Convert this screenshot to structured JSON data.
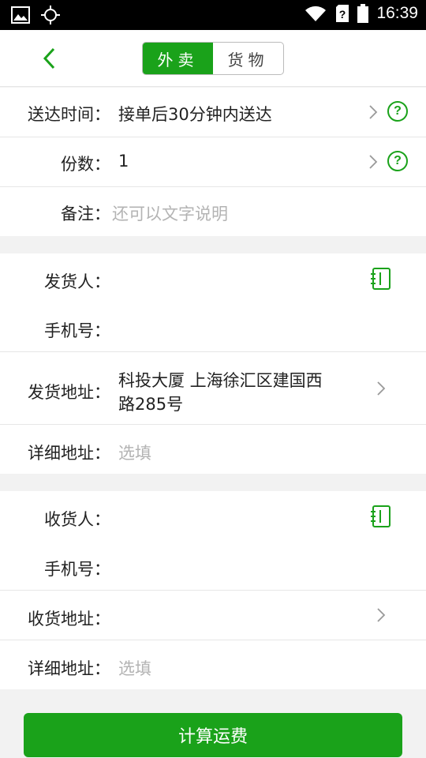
{
  "status_bar": {
    "time": "16:39",
    "icons": [
      "image-icon",
      "gps-icon",
      "wifi-icon",
      "sim-icon",
      "battery-icon"
    ]
  },
  "header": {
    "tabs": [
      {
        "label": "外卖",
        "active": true
      },
      {
        "label": "货物",
        "active": false
      }
    ]
  },
  "order": {
    "delivery_time_label": "送达时间：",
    "delivery_time_value": "接单后30分钟内送达",
    "portions_label": "份数：",
    "portions_value": "1",
    "note_label": "备注：",
    "note_placeholder": "还可以文字说明"
  },
  "sender": {
    "name_label": "发货人：",
    "phone_label": "手机号：",
    "address_label": "发货地址：",
    "address_line1": "科投大厦 上海徐汇区建国西",
    "address_line2": "路285号",
    "detail_label": "详细地址：",
    "detail_placeholder": "选填"
  },
  "receiver": {
    "name_label": "收货人：",
    "phone_label": "手机号：",
    "address_label": "收货地址：",
    "detail_label": "详细地址：",
    "detail_placeholder": "选填"
  },
  "actions": {
    "calculate_label": "计算运费",
    "help_glyph": "?"
  },
  "colors": {
    "accent": "#1aa21a",
    "placeholder": "#b3b3b3",
    "divider": "#e6e6e6",
    "background": "#f2f2f2"
  }
}
